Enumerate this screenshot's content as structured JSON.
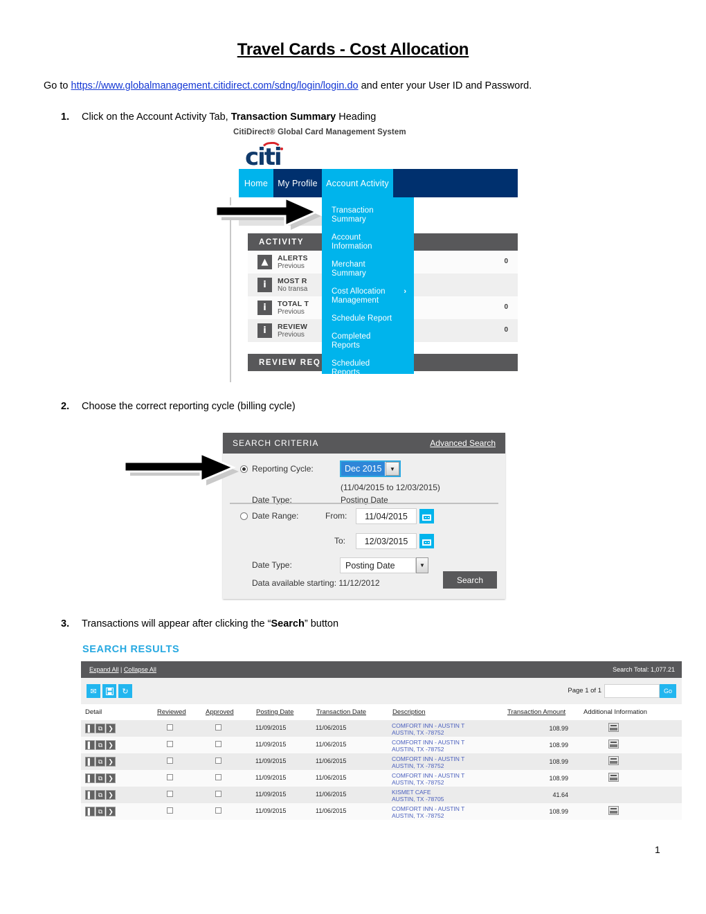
{
  "document": {
    "title": "Travel Cards - Cost Allocation",
    "intro_prefix": "Go to ",
    "intro_link": "https://www.globalmanagement.citidirect.com/sdng/login/login.do",
    "intro_suffix": " and enter your User ID and Password.",
    "page_number": "1",
    "steps": [
      {
        "num": "1.",
        "text_before": "Click on the Account Activity Tab, ",
        "bold": "Transaction Summary",
        "text_after": " Heading"
      },
      {
        "num": "2.",
        "text_before": "Choose the correct reporting cycle (billing cycle)",
        "bold": "",
        "text_after": ""
      },
      {
        "num": "3.",
        "text_before": "Transactions will appear after clicking the “",
        "bold": "Search",
        "text_after": "” button"
      }
    ]
  },
  "fig1": {
    "caption": "CitiDirect® Global Card Management System",
    "logo": "citi",
    "nav": [
      {
        "label": "Home",
        "active": false
      },
      {
        "label": "My Profile",
        "active": false
      },
      {
        "label": "Account Activity",
        "active": true
      }
    ],
    "dropdown_items": [
      {
        "label": "Transaction\nSummary",
        "submenu": false
      },
      {
        "label": "Account\nInformation",
        "submenu": false
      },
      {
        "label": "Merchant\nSummary",
        "submenu": false
      },
      {
        "label": "Cost Allocation\nManagement",
        "submenu": true
      },
      {
        "label": "Schedule Report",
        "submenu": false
      },
      {
        "label": "Completed\nReports",
        "submenu": false
      },
      {
        "label": "Scheduled\nReports",
        "submenu": false
      }
    ],
    "activity_panel_title": "ACTIVITY",
    "review_panel_title": "REVIEW REQ",
    "activity_rows": [
      {
        "icon": "warning-icon",
        "title": "ALERTS",
        "sub": "Previous",
        "count": "0"
      },
      {
        "icon": "info-icon",
        "title": "MOST R",
        "sub": "No transa",
        "count": ""
      },
      {
        "icon": "info-icon",
        "title": "TOTAL T",
        "sub": "Previous",
        "count": "0"
      },
      {
        "icon": "info-icon",
        "title": "REVIEW",
        "sub": "Previous",
        "count": "0"
      }
    ],
    "colors": {
      "cyan": "#00b4ec",
      "navy": "#00306e",
      "panel_grey": "#58585a"
    }
  },
  "fig2": {
    "header_title": "SEARCH CRITERIA",
    "advanced_search": "Advanced Search",
    "reporting_cycle_label": "Reporting Cycle:",
    "reporting_cycle_value": "Dec 2015",
    "reporting_cycle_range": "(11/04/2015 to 12/03/2015)",
    "date_type_label_top": "Date Type:",
    "date_type_value_top": "Posting Date",
    "date_range_label": "Date Range:",
    "from_label": "From:",
    "from_value": "11/04/2015",
    "to_label": "To:",
    "to_value": "12/03/2015",
    "date_type_label_bottom": "Date Type:",
    "date_type_value_bottom": "Posting Date",
    "data_available": "Data available starting: 11/12/2012",
    "search_button": "Search",
    "reporting_cycle_selected": true
  },
  "fig3": {
    "title": "SEARCH RESULTS",
    "expand_all": "Expand All",
    "separator": "|",
    "collapse_all": "Collapse All",
    "search_total": "Search Total: 1,077.21",
    "tools": [
      {
        "name": "email-icon",
        "glyph": "✉"
      },
      {
        "name": "save-icon",
        "glyph": "ὋE"
      },
      {
        "name": "history-icon",
        "glyph": "↻"
      }
    ],
    "page_label": "Page 1 of 1",
    "page_input_value": "",
    "go_button": "Go",
    "columns": [
      "Detail",
      "Reviewed",
      "Approved",
      "Posting Date",
      "Transaction Date",
      "Description",
      "Transaction Amount",
      "Additional Information"
    ],
    "rows": [
      {
        "posting_date": "11/09/2015",
        "transaction_date": "11/06/2015",
        "merchant": "COMFORT INN - AUSTIN T",
        "city": "AUSTIN, TX -78752",
        "amount": "108.99",
        "has_addl": true
      },
      {
        "posting_date": "11/09/2015",
        "transaction_date": "11/06/2015",
        "merchant": "COMFORT INN - AUSTIN T",
        "city": "AUSTIN, TX -78752",
        "amount": "108.99",
        "has_addl": true
      },
      {
        "posting_date": "11/09/2015",
        "transaction_date": "11/06/2015",
        "merchant": "COMFORT INN - AUSTIN T",
        "city": "AUSTIN, TX -78752",
        "amount": "108.99",
        "has_addl": true
      },
      {
        "posting_date": "11/09/2015",
        "transaction_date": "11/06/2015",
        "merchant": "COMFORT INN - AUSTIN T",
        "city": "AUSTIN, TX -78752",
        "amount": "108.99",
        "has_addl": true
      },
      {
        "posting_date": "11/09/2015",
        "transaction_date": "11/06/2015",
        "merchant": "KISMET CAFE",
        "city": "AUSTIN, TX -78705",
        "amount": "41.64",
        "has_addl": false
      },
      {
        "posting_date": "11/09/2015",
        "transaction_date": "11/06/2015",
        "merchant": "COMFORT INN - AUSTIN T",
        "city": "AUSTIN, TX -78752",
        "amount": "108.99",
        "has_addl": true
      }
    ]
  }
}
